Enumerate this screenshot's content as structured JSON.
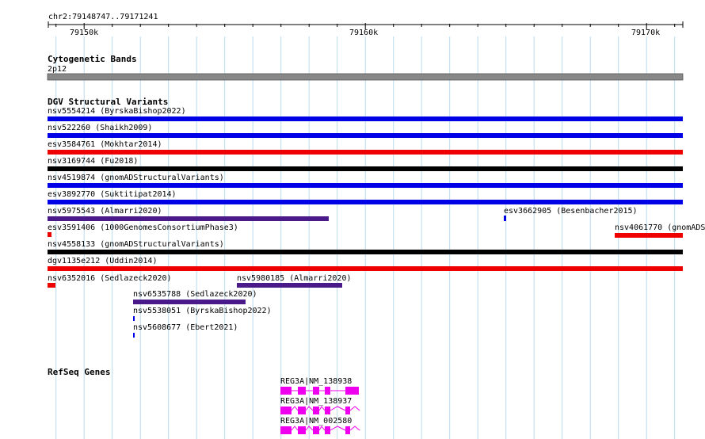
{
  "region": "chr2:79148747..79171241",
  "ruler": {
    "ticks": [
      "79150k",
      "79160k",
      "79170k"
    ]
  },
  "cytoband": {
    "title": "Cytogenetic Bands",
    "band": "2p12",
    "color": "#888888"
  },
  "dgv": {
    "title": "DGV Structural Variants",
    "colors": {
      "blue": "#0000e6",
      "red": "#ee0000",
      "black": "#000000",
      "purple": "#4b1a8a"
    },
    "features": [
      {
        "label": "nsv5554214 (ByrskaBishop2022)",
        "color": "blue"
      },
      {
        "label": "nsv522260 (Shaikh2009)",
        "color": "blue"
      },
      {
        "label": "esv3584761 (Mokhtar2014)",
        "color": "red"
      },
      {
        "label": "nsv3169744 (Fu2018)",
        "color": "black"
      },
      {
        "label": "nsv4519874 (gnomADStructuralVariants)",
        "color": "blue"
      },
      {
        "label": "esv3892770 (Suktitipat2014)",
        "color": "blue"
      },
      {
        "label": "nsv5975543 (Almarri2020)",
        "color": "purple"
      },
      {
        "label": "esv3662905 (Besenbacher2015)",
        "color": "blue"
      },
      {
        "label": "esv3591406 (1000GenomesConsortiumPhase3)",
        "color": "red"
      },
      {
        "label": "nsv4061770 (gnomADS",
        "color": "red"
      },
      {
        "label": "nsv4558133 (gnomADStructuralVariants)",
        "color": "black"
      },
      {
        "label": "dgv1135e212 (Uddin2014)",
        "color": "red"
      },
      {
        "label": "nsv6352016 (Sedlazeck2020)",
        "color": "red"
      },
      {
        "label": "nsv5980185 (Almarri2020)",
        "color": "purple"
      },
      {
        "label": "nsv6535788 (Sedlazeck2020)",
        "color": "purple"
      },
      {
        "label": "nsv5538051 (ByrskaBishop2022)",
        "color": "blue"
      },
      {
        "label": "nsv5608677 (Ebert2021)",
        "color": "blue"
      }
    ]
  },
  "refseq": {
    "title": "RefSeq Genes",
    "color": "#ee00ee",
    "genes": [
      {
        "label": "REG3A|NM_138938"
      },
      {
        "label": "REG3A|NM_138937"
      },
      {
        "label": "REG3A|NM_002580"
      }
    ]
  }
}
